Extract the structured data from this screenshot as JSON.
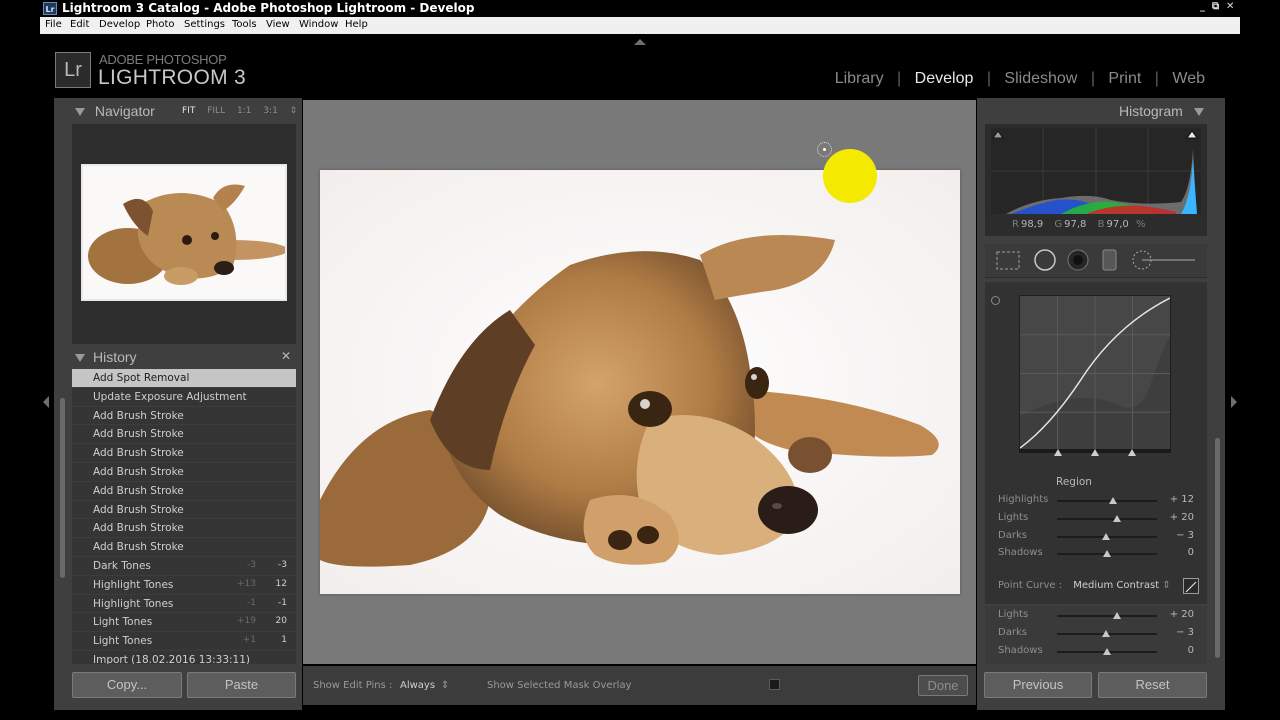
{
  "window": {
    "icon_text": "Lr",
    "title": "Lightroom 3 Catalog - Adobe Photoshop Lightroom - Develop",
    "controls": [
      "_",
      "⧉",
      "✕"
    ]
  },
  "menu": [
    "File",
    "Edit",
    "Develop",
    "Photo",
    "Settings",
    "Tools",
    "View",
    "Window",
    "Help"
  ],
  "identity": {
    "logo": "Lr",
    "line1": "ADOBE PHOTOSHOP",
    "line2": "LIGHTROOM 3"
  },
  "modules": {
    "items": [
      "Library",
      "Develop",
      "Slideshow",
      "Print",
      "Web"
    ],
    "active": "Develop",
    "separator": "|"
  },
  "navigator": {
    "title": "Navigator",
    "zoom": [
      "FIT",
      "FILL",
      "1:1",
      "3:1"
    ],
    "zoom_selected": "FIT",
    "zoom_arrow": "⇕"
  },
  "history": {
    "title": "History",
    "close": "✕",
    "items": [
      {
        "label": "Add Spot Removal",
        "v1": "",
        "v2": "",
        "selected": true
      },
      {
        "label": "Update Exposure Adjustment",
        "v1": "",
        "v2": ""
      },
      {
        "label": "Add Brush Stroke",
        "v1": "",
        "v2": ""
      },
      {
        "label": "Add Brush Stroke",
        "v1": "",
        "v2": ""
      },
      {
        "label": "Add Brush Stroke",
        "v1": "",
        "v2": ""
      },
      {
        "label": "Add Brush Stroke",
        "v1": "",
        "v2": ""
      },
      {
        "label": "Add Brush Stroke",
        "v1": "",
        "v2": ""
      },
      {
        "label": "Add Brush Stroke",
        "v1": "",
        "v2": ""
      },
      {
        "label": "Add Brush Stroke",
        "v1": "",
        "v2": ""
      },
      {
        "label": "Add Brush Stroke",
        "v1": "",
        "v2": ""
      },
      {
        "label": "Dark Tones",
        "v1": "-3",
        "v2": "-3"
      },
      {
        "label": "Highlight Tones",
        "v1": "+13",
        "v2": "12"
      },
      {
        "label": "Highlight Tones",
        "v1": "-1",
        "v2": "-1"
      },
      {
        "label": "Light Tones",
        "v1": "+19",
        "v2": "20"
      },
      {
        "label": "Light Tones",
        "v1": "+1",
        "v2": "1"
      },
      {
        "label": "Import (18.02.2016 13:33:11)",
        "v1": "",
        "v2": ""
      }
    ]
  },
  "left_buttons": {
    "copy": "Copy...",
    "paste": "Paste"
  },
  "toolbar": {
    "show_edit_pins_label": "Show Edit Pins :",
    "show_edit_pins_value": "Always",
    "select_arrow": "⇕",
    "mask_overlay_label": "Show Selected Mask Overlay",
    "done": "Done"
  },
  "histogram": {
    "title": "Histogram",
    "r_label": "R",
    "r_value": "98,9",
    "g_label": "G",
    "g_value": "97,8",
    "b_label": "B",
    "b_value": "97,0",
    "unit": "%"
  },
  "tone_curve": {
    "region_title": "Region",
    "sliders": [
      {
        "label": "Highlights",
        "value": "+ 12",
        "level": 0.56
      },
      {
        "label": "Lights",
        "value": "+ 20",
        "level": 0.6
      },
      {
        "label": "Darks",
        "value": "− 3",
        "level": 0.49
      },
      {
        "label": "Shadows",
        "value": "0",
        "level": 0.5
      }
    ],
    "point_curve_label": "Point Curve :",
    "point_curve_value": "Medium Contrast",
    "point_curve_arrow": "⇕"
  },
  "lower_sliders": [
    {
      "label": "Lights",
      "value": "+ 20",
      "level": 0.6
    },
    {
      "label": "Darks",
      "value": "− 3",
      "level": 0.49
    },
    {
      "label": "Shadows",
      "value": "0",
      "level": 0.5
    }
  ],
  "right_buttons": {
    "previous": "Previous",
    "reset": "Reset"
  },
  "colors": {
    "accent_active": "#e8e8e8",
    "panel_bg": "#3f3f3f",
    "workspace_bg": "#797979",
    "spot_pin": "#f3ea00"
  }
}
